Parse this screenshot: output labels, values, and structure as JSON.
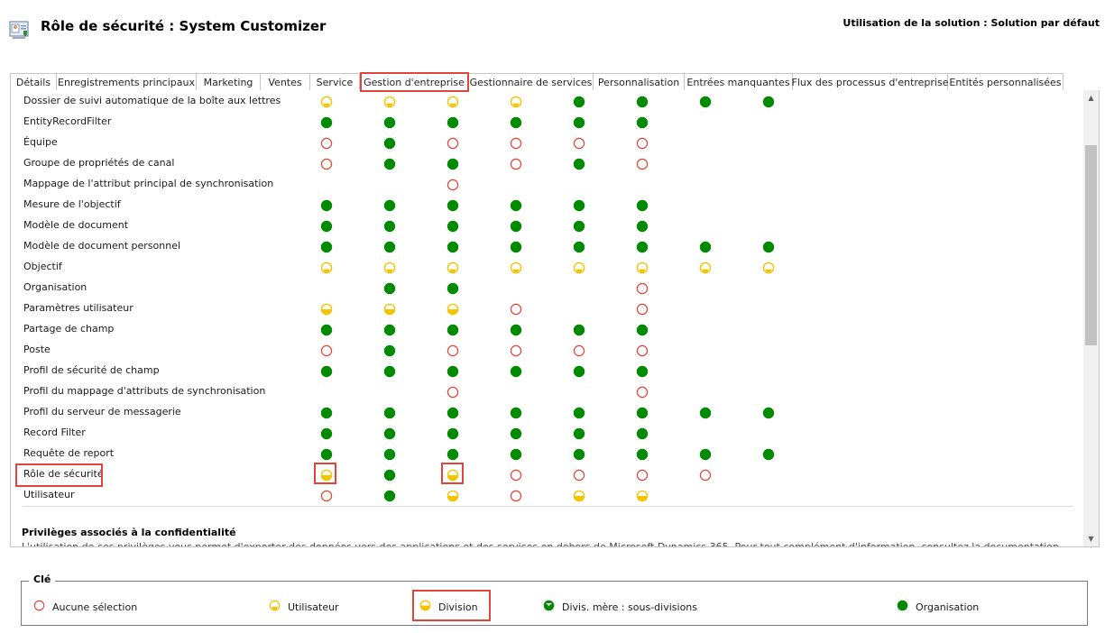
{
  "header": {
    "title": "Rôle de sécurité : System Customizer",
    "solution": "Utilisation de la solution : Solution par défaut"
  },
  "tabs": [
    {
      "label": "Détails"
    },
    {
      "label": "Enregistrements principaux"
    },
    {
      "label": "Marketing"
    },
    {
      "label": "Ventes"
    },
    {
      "label": "Service"
    },
    {
      "label": "Gestion d'entreprise"
    },
    {
      "label": "Gestionnaire de services"
    },
    {
      "label": "Personnalisation"
    },
    {
      "label": "Entrées manquantes"
    },
    {
      "label": "Flux des processus d'entreprise"
    },
    {
      "label": "Entités personnalisées"
    }
  ],
  "active_tab": "Gestion d'entreprise",
  "privilege_levels": [
    "none",
    "user",
    "business-unit",
    "parent-child",
    "organization"
  ],
  "rows": [
    {
      "label": "Dossier de suivi automatique de la boîte aux lettres",
      "cells": [
        "user",
        "user",
        "user",
        "user",
        "org",
        "org",
        "org",
        "org"
      ]
    },
    {
      "label": "EntityRecordFilter",
      "cells": [
        "org",
        "org",
        "org",
        "org",
        "org",
        "org",
        "",
        ""
      ]
    },
    {
      "label": "Équipe",
      "cells": [
        "none",
        "org",
        "none",
        "none",
        "none",
        "none",
        "",
        ""
      ]
    },
    {
      "label": "Groupe de propriétés de canal",
      "cells": [
        "none",
        "org",
        "org",
        "none",
        "org",
        "none",
        "",
        ""
      ]
    },
    {
      "label": "Mappage de l'attribut principal de synchronisation",
      "cells": [
        "",
        "",
        "none",
        "",
        "",
        "",
        "",
        ""
      ]
    },
    {
      "label": "Mesure de l'objectif",
      "cells": [
        "org",
        "org",
        "org",
        "org",
        "org",
        "org",
        "",
        ""
      ]
    },
    {
      "label": "Modèle de document",
      "cells": [
        "org",
        "org",
        "org",
        "org",
        "org",
        "org",
        "",
        ""
      ]
    },
    {
      "label": "Modèle de document personnel",
      "cells": [
        "org",
        "org",
        "org",
        "org",
        "org",
        "org",
        "org",
        "org"
      ]
    },
    {
      "label": "Objectif",
      "cells": [
        "user",
        "user",
        "user",
        "user",
        "user",
        "user",
        "user",
        "user"
      ]
    },
    {
      "label": "Organisation",
      "cells": [
        "",
        "org",
        "org",
        "",
        "",
        "none",
        "",
        ""
      ]
    },
    {
      "label": "Paramètres utilisateur",
      "cells": [
        "bu",
        "bu",
        "bu",
        "none",
        "",
        "none",
        "",
        ""
      ]
    },
    {
      "label": "Partage de champ",
      "cells": [
        "org",
        "org",
        "org",
        "org",
        "org",
        "org",
        "",
        ""
      ]
    },
    {
      "label": "Poste",
      "cells": [
        "none",
        "org",
        "none",
        "none",
        "none",
        "none",
        "",
        ""
      ]
    },
    {
      "label": "Profil de sécurité de champ",
      "cells": [
        "org",
        "org",
        "org",
        "org",
        "org",
        "org",
        "",
        ""
      ]
    },
    {
      "label": "Profil du mappage d'attributs de synchronisation",
      "cells": [
        "",
        "",
        "none",
        "",
        "",
        "none",
        "",
        ""
      ]
    },
    {
      "label": "Profil du serveur de messagerie",
      "cells": [
        "org",
        "org",
        "org",
        "org",
        "org",
        "org",
        "org",
        "org"
      ]
    },
    {
      "label": "Record Filter",
      "cells": [
        "org",
        "org",
        "org",
        "org",
        "org",
        "org",
        "",
        ""
      ]
    },
    {
      "label": "Requête de report",
      "cells": [
        "org",
        "org",
        "org",
        "org",
        "org",
        "org",
        "org",
        "org"
      ]
    },
    {
      "label": "Rôle de sécurité",
      "cells": [
        "bu",
        "org",
        "bu",
        "none",
        "none",
        "none",
        "none",
        ""
      ]
    },
    {
      "label": "Utilisateur",
      "cells": [
        "none",
        "org",
        "bu",
        "none",
        "bu",
        "bu",
        "",
        ""
      ]
    }
  ],
  "section": {
    "title": "Privilèges associés à la confidentialité",
    "text": "L'utilisation de ces privilèges vous permet d'exporter des données vers des applications et des services en dehors de Microsoft Dynamics 365. Pour tout complément d'information, consultez la documentation."
  },
  "legend": {
    "title": "Clé",
    "items": [
      {
        "kind": "none",
        "label": "Aucune sélection"
      },
      {
        "kind": "user",
        "label": "Utilisateur"
      },
      {
        "kind": "bu",
        "label": "Division"
      },
      {
        "kind": "pc",
        "label": "Divis. mère : sous-divisions"
      },
      {
        "kind": "org",
        "label": "Organisation"
      }
    ]
  },
  "colors": {
    "organization": "#008a00",
    "user_division": "#f5c400",
    "none": "#e0443a",
    "highlight": "#e0443a"
  }
}
